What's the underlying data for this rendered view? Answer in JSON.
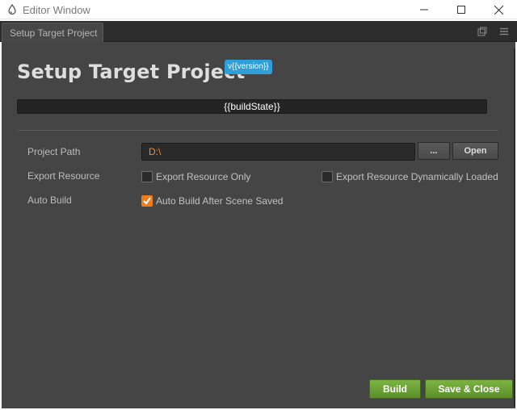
{
  "window": {
    "title": "Editor Window",
    "icon": "drop-icon"
  },
  "tab": {
    "label": "Setup Target Project",
    "tools": [
      "popout-icon",
      "menu-icon"
    ]
  },
  "panel": {
    "heading": "Setup Target Project",
    "version_badge": "v{{version}}",
    "build_state": "{{buildState}}"
  },
  "form": {
    "project_path": {
      "label": "Project Path",
      "value": "D:\\",
      "browse_label": "...",
      "open_label": "Open"
    },
    "export_resource": {
      "label": "Export Resource",
      "option_only": {
        "label": "Export Resource Only",
        "checked": false
      },
      "option_dynamic": {
        "label": "Export Resource Dynamically Loaded",
        "checked": false
      }
    },
    "auto_build": {
      "label": "Auto Build",
      "option": {
        "label": "Auto Build After Scene Saved",
        "checked": true
      }
    }
  },
  "footer": {
    "build_label": "Build",
    "save_close_label": "Save & Close"
  },
  "colors": {
    "accent_orange": "#f07c1e",
    "path_text": "#f08b2d",
    "badge_blue": "#2e9fd8",
    "button_green": "#6ca336",
    "panel_bg": "#454545"
  }
}
